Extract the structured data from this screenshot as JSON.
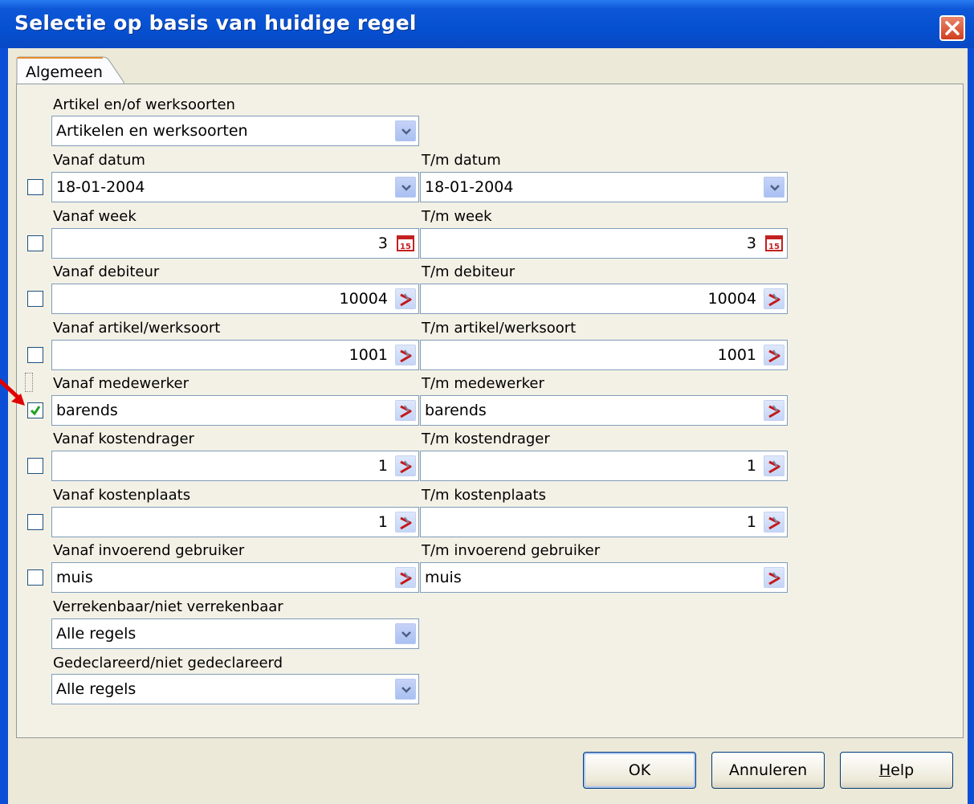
{
  "dialog": {
    "title": "Selectie op basis van huidige regel",
    "tab": "Algemeen"
  },
  "article_type": {
    "label": "Artikel en/of werksoorten",
    "value": "Artikelen en werksoorten"
  },
  "rows": [
    {
      "from_label": "Vanaf datum",
      "to_label": "T/m datum",
      "from_value": "18-01-2004",
      "to_value": "18-01-2004",
      "checked": false,
      "control": "dropdown"
    },
    {
      "from_label": "Vanaf week",
      "to_label": "T/m week",
      "from_value": "3",
      "to_value": "3",
      "checked": false,
      "control": "calendar"
    },
    {
      "from_label": "Vanaf debiteur",
      "to_label": "T/m debiteur",
      "from_value": "10004",
      "to_value": "10004",
      "checked": false,
      "control": "lookup"
    },
    {
      "from_label": "Vanaf artikel/werksoort",
      "to_label": "T/m artikel/werksoort",
      "from_value": "1001",
      "to_value": "1001",
      "checked": false,
      "control": "lookup"
    },
    {
      "from_label": "Vanaf medewerker",
      "to_label": "T/m medewerker",
      "from_value": "barends",
      "to_value": "barends",
      "checked": true,
      "control": "lookup"
    },
    {
      "from_label": "Vanaf kostendrager",
      "to_label": "T/m kostendrager",
      "from_value": "1",
      "to_value": "1",
      "checked": false,
      "control": "lookup"
    },
    {
      "from_label": "Vanaf kostenplaats",
      "to_label": "T/m kostenplaats",
      "from_value": "1",
      "to_value": "1",
      "checked": false,
      "control": "lookup"
    },
    {
      "from_label": "Vanaf invoerend gebruiker",
      "to_label": "T/m invoerend gebruiker",
      "from_value": "muis",
      "to_value": "muis",
      "checked": false,
      "control": "lookup"
    }
  ],
  "billable": {
    "label": "Verrekenbaar/niet verrekenbaar",
    "value": "Alle regels"
  },
  "declared": {
    "label": "Gedeclareerd/niet gedeclareerd",
    "value": "Alle regels"
  },
  "calendar_icon_text": "15",
  "buttons": {
    "ok": "OK",
    "cancel": "Annuleren",
    "help_first": "H",
    "help_rest": "elp"
  },
  "colors": {
    "titlebar": "#0550d0",
    "close": "#cf3e1f",
    "annotation_arrow": "#e00000",
    "check": "#21a121"
  }
}
